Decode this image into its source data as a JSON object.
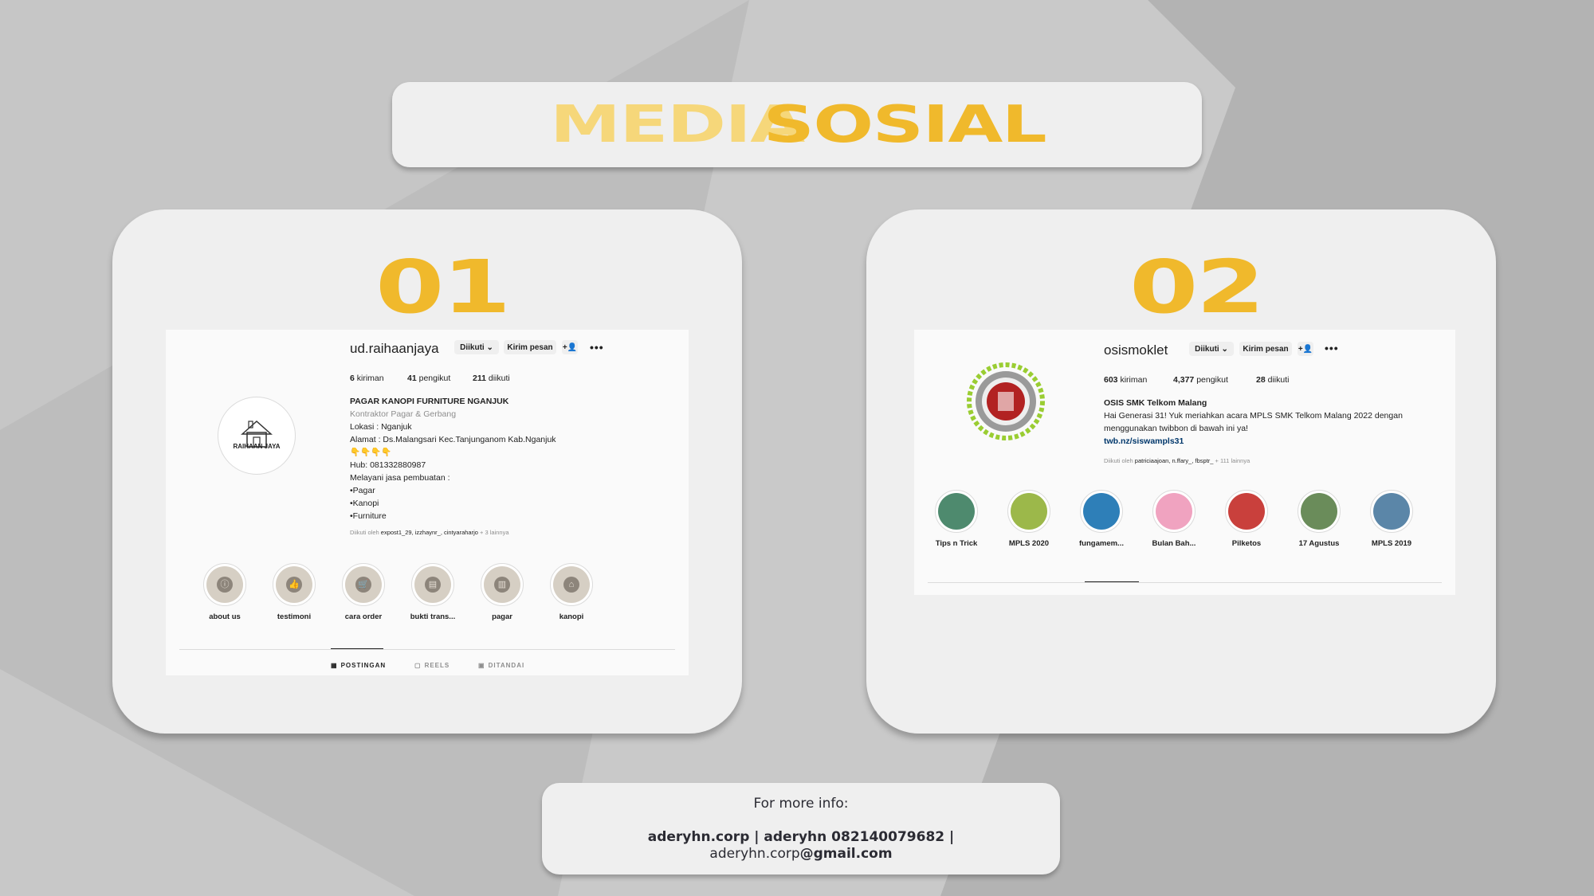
{
  "header": {
    "title_part1": "MEDIA",
    "title_part2": "SOSIAL"
  },
  "cards": [
    {
      "number": "01",
      "profile": {
        "username": "ud.raihaanjaya",
        "follow_button": "Diikuti",
        "message_button": "Kirim pesan",
        "more": "•••",
        "stats": {
          "posts": "6",
          "posts_label": "kiriman",
          "followers": "41",
          "followers_label": "pengikut",
          "following": "211",
          "following_label": "diikuti"
        },
        "logo_text": "RAIHAAN JAYA",
        "bio": {
          "name": "PAGAR KANOPI FURNITURE NGANJUK",
          "category": "Kontraktor Pagar & Gerbang",
          "lines": [
            "Lokasi : Nganjuk",
            "Alamat : Ds.Malangsari Kec.Tanjunganom Kab.Nganjuk",
            "👇👇👇👇",
            "Hub: 081332880987",
            "Melayani jasa pembuatan :",
            "•Pagar",
            "•Kanopi",
            "•Furniture"
          ]
        },
        "followed_by": {
          "prefix": "Diikuti oleh",
          "names": "expost1_29, izzhaynr_, cintyaraharjo",
          "suffix": "+ 3 lainnya"
        },
        "highlights": [
          "about us",
          "testimoni",
          "cara order",
          "bukti trans...",
          "pagar",
          "kanopi"
        ],
        "tabs": [
          "POSTINGAN",
          "REELS",
          "DITANDAI"
        ]
      }
    },
    {
      "number": "02",
      "profile": {
        "username": "osismoklet",
        "follow_button": "Diikuti",
        "message_button": "Kirim pesan",
        "more": "•••",
        "stats": {
          "posts": "603",
          "posts_label": "kiriman",
          "followers": "4,377",
          "followers_label": "pengikut",
          "following": "28",
          "following_label": "diikuti"
        },
        "bio": {
          "name": "OSIS SMK Telkom Malang",
          "line1": "Hai Generasi 31! Yuk meriahkan acara MPLS SMK Telkom Malang 2022 dengan",
          "line2": "menggunakan twibbon di bawah ini ya!",
          "link": "twb.nz/siswampls31"
        },
        "followed_by": {
          "prefix": "Diikuti oleh",
          "names": "patriciaajoan, n.ffary_, fbsptr_",
          "suffix": "+ 111 lainnya"
        },
        "highlights": [
          "Tips n Trick",
          "MPLS 2020",
          "fungamem...",
          "Bulan Bah...",
          "Pilketos",
          "17 Agustus",
          "MPLS 2019"
        ]
      }
    }
  ],
  "footer": {
    "label": "For more info:",
    "contacts": "aderyhn.corp | aderyhn 082140079682 |",
    "email_user": "aderyhn.corp",
    "email_domain": "@gmail.com"
  },
  "colors": {
    "accent": "#f0b92c",
    "accent_light": "#f6d77a",
    "card": "#efefef",
    "background": "#bdbdbd"
  }
}
